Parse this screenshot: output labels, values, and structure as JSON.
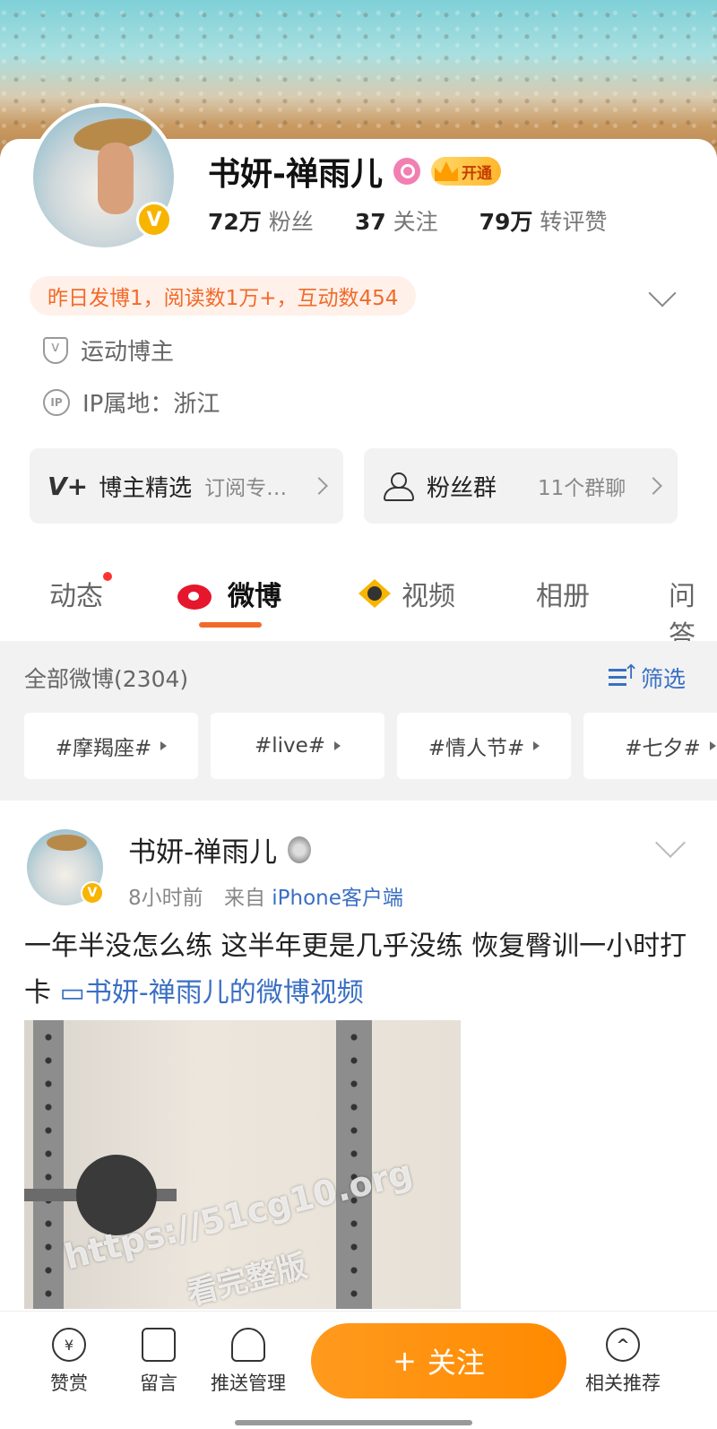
{
  "profile": {
    "name": "书妍-禅雨儿",
    "vip_label": "开通",
    "verified_badge": "V",
    "stats": [
      {
        "value": "72万",
        "label": "粉丝"
      },
      {
        "value": "37",
        "label": "关注"
      },
      {
        "value": "79万",
        "label": "转评赞"
      }
    ],
    "summary": "昨日发博1，阅读数1万+，互动数454",
    "tag": "运动博主",
    "ip": "IP属地：浙江",
    "ip_icon": "IP"
  },
  "boxes": {
    "left": {
      "icon": "V+",
      "title": "博主精选",
      "sub": "订阅专…"
    },
    "right": {
      "title": "粉丝群",
      "sub": "11个群聊"
    }
  },
  "tabs": [
    {
      "label": "动态"
    },
    {
      "label": "微博"
    },
    {
      "label": "视频"
    },
    {
      "label": "相册"
    },
    {
      "label": "问答"
    }
  ],
  "feed": {
    "all_label": "全部微博(2304)",
    "filter_label": "筛选",
    "topics": [
      "#摩羯座#",
      "#live#",
      "#情人节#",
      "#七夕#"
    ]
  },
  "post": {
    "author": "书妍-禅雨儿",
    "time": "8小时前",
    "from_label": "来自",
    "client": "iPhone客户端",
    "text": "一年半没怎么练 这半年更是几乎没练 恢复臀训一小时打卡",
    "video_link": "书妍-禅雨儿的微博视频",
    "watermark_line1": "https://51cg10.org",
    "watermark_line2": "看完整版"
  },
  "bottom_bar": {
    "reward": "赞赏",
    "reward_icon": "¥",
    "comment": "留言",
    "push": "推送管理",
    "follow": "关注",
    "follow_plus": "+",
    "related": "相关推荐",
    "related_icon": "^"
  },
  "colors": {
    "accent_orange": "#f26a2a",
    "follow_orange": "#ff8a00",
    "link_blue": "#3a6fc3",
    "verified_yellow": "#f7b500"
  }
}
